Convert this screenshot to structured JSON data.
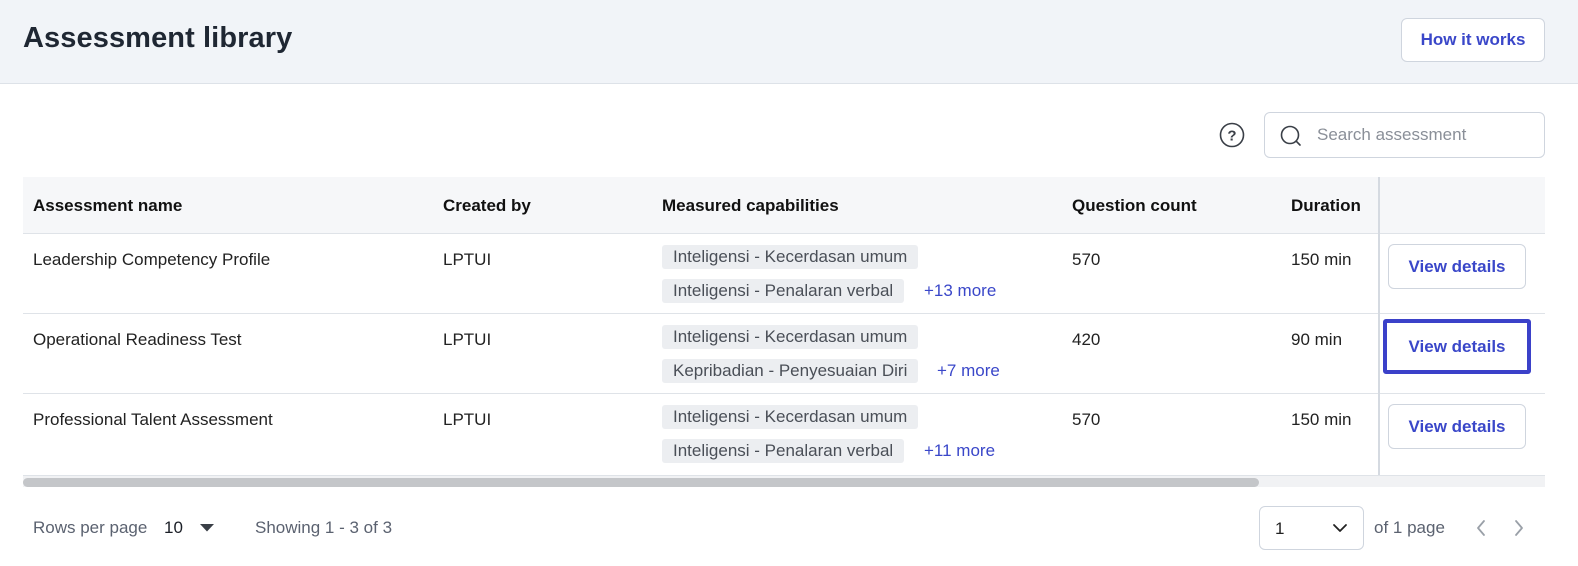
{
  "header": {
    "title": "Assessment library",
    "how_it_works": "How it works"
  },
  "toolbar": {
    "search_placeholder": "Search assessment"
  },
  "table": {
    "columns": [
      "Assessment name",
      "Created by",
      "Measured capabilities",
      "Question count",
      "Duration"
    ],
    "rows": [
      {
        "name": "Leadership Competency Profile",
        "created_by": "LPTUI",
        "tags": [
          "Inteligensi - Kecerdasan umum",
          "Inteligensi - Penalaran verbal"
        ],
        "more": "+13 more",
        "questions": "570",
        "duration": "150 min",
        "action": "View details"
      },
      {
        "name": "Operational Readiness Test",
        "created_by": "LPTUI",
        "tags": [
          "Inteligensi - Kecerdasan umum",
          "Kepribadian - Penyesuaian Diri"
        ],
        "more": "+7 more",
        "questions": "420",
        "duration": "90 min",
        "action": "View details"
      },
      {
        "name": "Professional Talent Assessment",
        "created_by": "LPTUI",
        "tags": [
          "Inteligensi - Kecerdasan umum",
          "Inteligensi - Penalaran verbal"
        ],
        "more": "+11 more",
        "questions": "570",
        "duration": "150 min",
        "action": "View details"
      }
    ]
  },
  "footer": {
    "rows_per_page_label": "Rows per page",
    "rows_per_page_value": "10",
    "showing": "Showing 1 - 3 of 3",
    "page_value": "1",
    "page_of": "of 1 page"
  },
  "colors": {
    "accent": "#3a47c9",
    "focus_ring": "#3b41c9",
    "header_bg": "#f1f4f8"
  },
  "icons": [
    "help-circle-icon",
    "search-icon",
    "chevron-down-icon",
    "caret-down-icon",
    "chevron-left-icon",
    "chevron-right-icon"
  ]
}
